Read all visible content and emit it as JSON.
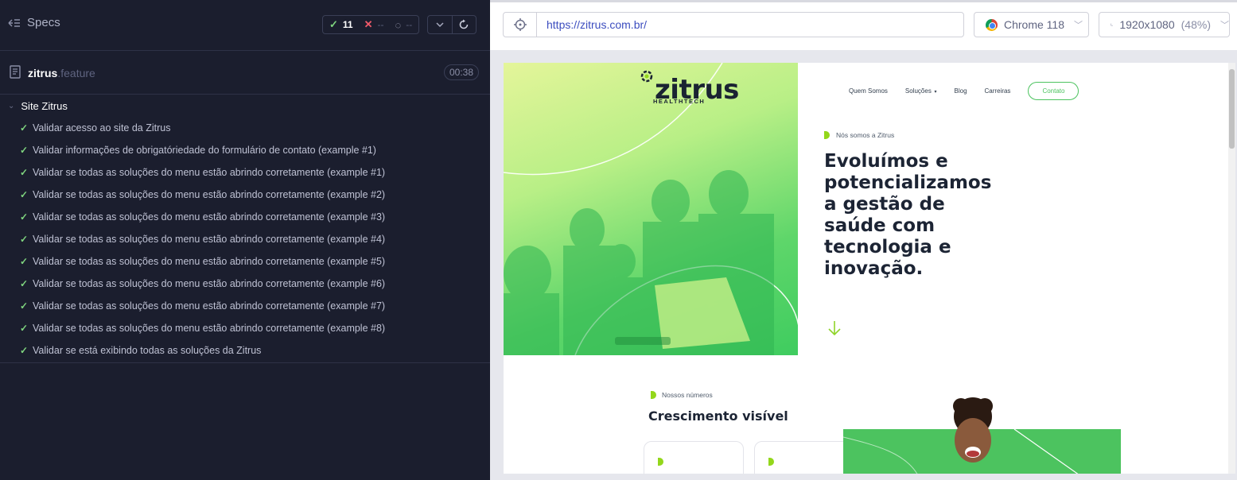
{
  "reporter": {
    "specs_label": "Specs",
    "stats": {
      "passed": "11",
      "failed": "--",
      "pending": "--"
    },
    "file": {
      "name": "zitrus",
      "ext": ".feature",
      "duration": "00:38"
    },
    "suite": {
      "title": "Site Zitrus",
      "tests": [
        "Validar acesso ao site da Zitrus",
        "Validar informações de obrigatóriedade do formulário de contato (example #1)",
        "Validar se todas as soluções do menu estão abrindo corretamente (example #1)",
        "Validar se todas as soluções do menu estão abrindo corretamente (example #2)",
        "Validar se todas as soluções do menu estão abrindo corretamente (example #3)",
        "Validar se todas as soluções do menu estão abrindo corretamente (example #4)",
        "Validar se todas as soluções do menu estão abrindo corretamente (example #5)",
        "Validar se todas as soluções do menu estão abrindo corretamente (example #6)",
        "Validar se todas as soluções do menu estão abrindo corretamente (example #7)",
        "Validar se todas as soluções do menu estão abrindo corretamente (example #8)",
        "Validar se está exibindo todas as soluções da Zitrus"
      ]
    }
  },
  "aut": {
    "url": "https://zitrus.com.br/",
    "browser": "Chrome 118",
    "viewport": "1920x1080",
    "viewport_scale": "(48%)"
  },
  "site": {
    "logo_text": "zitrus",
    "logo_sub": "HEALTHTECH",
    "nav": [
      "Quem Somos",
      "Soluções",
      "Blog",
      "Carreiras"
    ],
    "contact_button": "Contato",
    "eyebrow": "Nós somos a Zitrus",
    "headline": "Evoluímos e potencializamos a gestão de saúde com tecnologia e inovação.",
    "numbers_eyebrow": "Nossos números",
    "numbers_title": "Crescimento visível",
    "colors": {
      "green": "#4cc35f",
      "lime": "#93d71b",
      "dark": "#1c2434"
    }
  }
}
